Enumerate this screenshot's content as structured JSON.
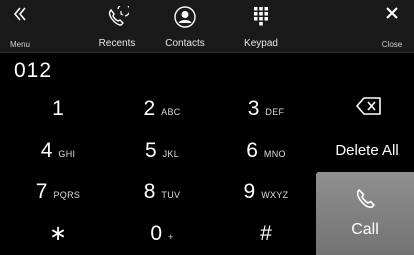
{
  "nav": {
    "menu": {
      "label": "Menu",
      "icon": "double-chevron-left-icon"
    },
    "recents": {
      "label": "Recents",
      "icon": "phone-recents-icon"
    },
    "contacts": {
      "label": "Contacts",
      "icon": "contact-person-icon"
    },
    "keypad": {
      "label": "Keypad",
      "icon": "keypad-grid-icon"
    },
    "close": {
      "label": "Close",
      "icon": "close-icon"
    }
  },
  "number_display": {
    "value": "012"
  },
  "keys": [
    {
      "digit": "1",
      "letters": ""
    },
    {
      "digit": "2",
      "letters": "ABC"
    },
    {
      "digit": "3",
      "letters": "DEF"
    },
    {
      "digit": "4",
      "letters": "GHI"
    },
    {
      "digit": "5",
      "letters": "JKL"
    },
    {
      "digit": "6",
      "letters": "MNO"
    },
    {
      "digit": "7",
      "letters": "PQRS"
    },
    {
      "digit": "8",
      "letters": "TUV"
    },
    {
      "digit": "9",
      "letters": "WXYZ"
    },
    {
      "digit": "∗",
      "letters": ""
    },
    {
      "digit": "0",
      "letters": "+"
    },
    {
      "digit": "#",
      "letters": ""
    }
  ],
  "actions": {
    "backspace_icon": "backspace-icon",
    "delete_all": "Delete All",
    "call": "Call",
    "call_icon": "phone-handset-icon"
  },
  "colors": {
    "background": "#000000",
    "topbar": "#1a1a1a",
    "call_button": "#808080"
  }
}
